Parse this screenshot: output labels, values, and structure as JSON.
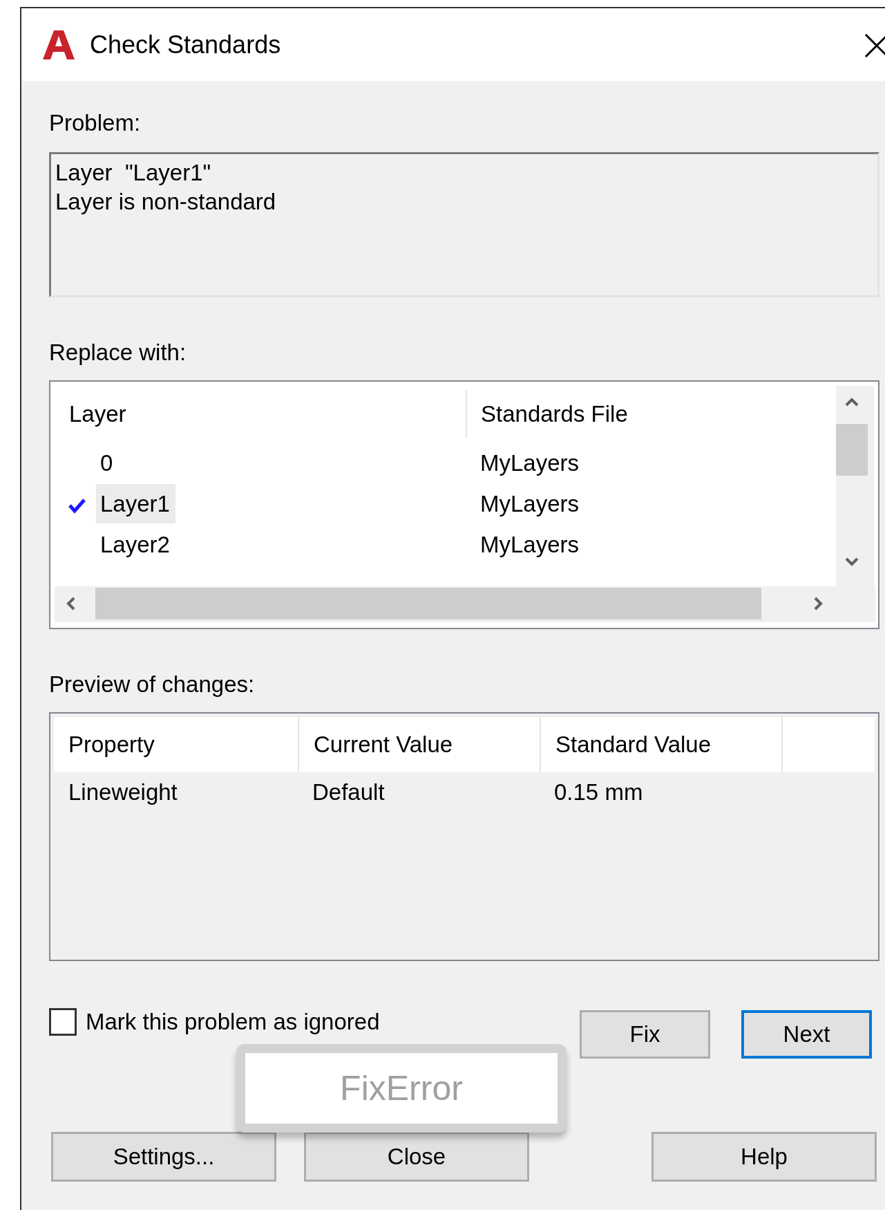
{
  "window": {
    "title": "Check Standards"
  },
  "problem": {
    "label": "Problem:",
    "lines": [
      "Layer  \"Layer1\"",
      "Layer is non-standard"
    ]
  },
  "replace": {
    "label": "Replace with:",
    "columns": [
      "Layer",
      "Standards File"
    ],
    "rows": [
      {
        "layer": "0",
        "file": "MyLayers",
        "selected": false
      },
      {
        "layer": "Layer1",
        "file": "MyLayers",
        "selected": true
      },
      {
        "layer": "Layer2",
        "file": "MyLayers",
        "selected": false
      }
    ]
  },
  "preview": {
    "label": "Preview of changes:",
    "columns": [
      "Property",
      "Current Value",
      "Standard Value"
    ],
    "rows": [
      [
        "Lineweight",
        "Default",
        "0.15 mm"
      ]
    ]
  },
  "ignore": {
    "label": "Mark this problem as ignored",
    "checked": false
  },
  "buttons": [
    {
      "label": "Fix",
      "default": false
    },
    {
      "label": "Next",
      "default": true
    }
  ],
  "tooltip": "FixError",
  "footer_buttons": [
    "Settings...",
    "Close",
    "Help"
  ]
}
